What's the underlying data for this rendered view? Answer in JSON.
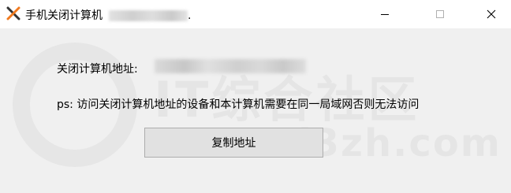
{
  "window": {
    "title": "手机关闭计算机",
    "title_suffix": "."
  },
  "watermark": {
    "brand_text": "IT综合社区",
    "url_text": "www.i3zh.com"
  },
  "form": {
    "address_label": "关闭计算机地址:",
    "note": "ps: 访问关闭计算机地址的设备和本计算机需要在同一局域网否则无法访问",
    "copy_button_label": "复制地址"
  },
  "icons": {
    "app": "app-logo-icon",
    "minimize": "minimize-icon",
    "maximize": "maximize-icon",
    "close": "close-icon"
  },
  "colors": {
    "titlebar": "#ffffff",
    "body": "#f0f0f0",
    "button": "#e1e1e1",
    "button_border": "#adadad",
    "logo_orange": "#f07a1f",
    "logo_dark": "#333333"
  }
}
